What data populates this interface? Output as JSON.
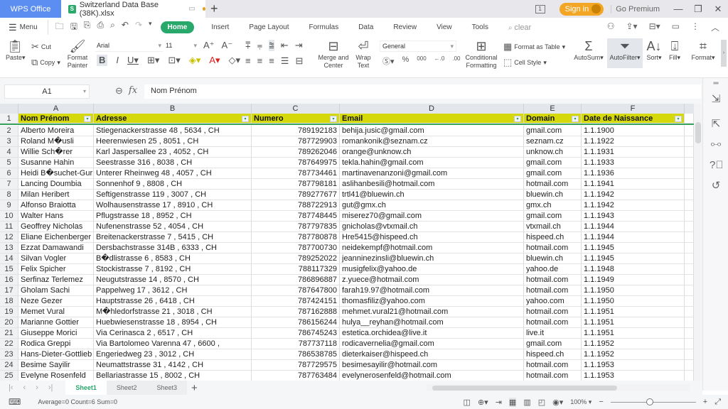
{
  "titlebar": {
    "app_tab": "WPS Office",
    "file_tab": "Switzerland Data Base (38K).xlsx",
    "file_icon": "S",
    "new_tab": "+",
    "window_count": "1",
    "sign_in": "Sign in",
    "go_premium": "Go Premium",
    "minimize": "—",
    "restore": "❐",
    "close": "✕"
  },
  "menubar": {
    "menu": "Menu",
    "tabs": [
      "Home",
      "Insert",
      "Page Layout",
      "Formulas",
      "Data",
      "Review",
      "View",
      "Tools"
    ],
    "search": "clear"
  },
  "ribbon": {
    "paste": "Paste",
    "cut": "Cut",
    "copy": "Copy",
    "format_painter": "Format Painter",
    "font": "Arial",
    "font_size": "11",
    "merge_center": "Merge and Center",
    "wrap_text": "Wrap Text",
    "number_format": "General",
    "conditional_formatting": "Conditional Formatting",
    "format_as_table": "Format as Table",
    "cell_style": "Cell Style",
    "autosum": "AutoSum",
    "autofilter": "AutoFilter",
    "sort": "Sort",
    "fill": "Fill",
    "format": "Format"
  },
  "formulabar": {
    "cell_ref": "A1",
    "fx": "fx",
    "content": "Nom Prénom"
  },
  "grid": {
    "columns": [
      "A",
      "B",
      "C",
      "D",
      "E",
      "F"
    ],
    "headers": [
      "Nom Prénom",
      "Adresse",
      "Numero",
      "Email",
      "Domain",
      "Date de Naissance"
    ],
    "rows": [
      {
        "n": "2",
        "name": "Alberto Moreira",
        "addr": "Stiegenackerstrasse  48  ,  5634  ,  CH",
        "num": "789192183",
        "email": "behija.jusic@gmail.com",
        "domain": "gmail.com",
        "date": "1.1.1900"
      },
      {
        "n": "3",
        "name": "Roland M�usli",
        "addr": "Heerenwiesen  25  ,  8051  ,  CH",
        "num": "787729903",
        "email": "romankonik@seznam.cz",
        "domain": "seznam.cz",
        "date": "1.1.1922"
      },
      {
        "n": "4",
        "name": "Willie Sch�rer",
        "addr": "Karl  Jaspersallee  23  ,  4052  ,  CH",
        "num": "789262046",
        "email": "orange@unknow.ch",
        "domain": "unknow.ch",
        "date": "1.1.1931"
      },
      {
        "n": "5",
        "name": "Susanne Hahin",
        "addr": "Seestrasse  316  ,  8038  ,  CH",
        "num": "787649975",
        "email": "tekla.hahin@gmail.com",
        "domain": "gmail.com",
        "date": "1.1.1933"
      },
      {
        "n": "6",
        "name": "Heidi B�suchet-Gur",
        "addr": "Unterer  Rheinweg  48  ,  4057  ,  CH",
        "num": "787734461",
        "email": "martinavenanzoni@gmail.com",
        "domain": "gmail.com",
        "date": "1.1.1936"
      },
      {
        "n": "7",
        "name": "Lancing Doumbia",
        "addr": "Sonnenhof  9  ,  8808  ,  CH",
        "num": "787798181",
        "email": "aslihanbesili@hotmail.com",
        "domain": "hotmail.com",
        "date": "1.1.1941"
      },
      {
        "n": "8",
        "name": "Milan Heribert",
        "addr": "Seftigenstrasse  119  ,  3007  ,  CH",
        "num": "789277677",
        "email": "trtl41@bluewin.ch",
        "domain": "bluewin.ch",
        "date": "1.1.1942"
      },
      {
        "n": "9",
        "name": "Alfonso Braiotta",
        "addr": "Wolhausenstrasse  17  ,  8910  ,  CH",
        "num": "788722913",
        "email": "gut@gmx.ch",
        "domain": "gmx.ch",
        "date": "1.1.1942"
      },
      {
        "n": "10",
        "name": "Walter Hans",
        "addr": "Pflugstrasse  18  ,  8952  ,  CH",
        "num": "787748445",
        "email": "miserez70@gmail.com",
        "domain": "gmail.com",
        "date": "1.1.1943"
      },
      {
        "n": "11",
        "name": "Geoffrey Nicholas",
        "addr": "Nufenenstrasse  52  ,  4054  ,  CH",
        "num": "787797835",
        "email": "gnicholas@vtxmail.ch",
        "domain": "vtxmail.ch",
        "date": "1.1.1944"
      },
      {
        "n": "12",
        "name": "Eliane Eichenberger",
        "addr": "Breitenackerstrasse  7  ,  5415  ,  CH",
        "num": "787780878",
        "email": "Hre5415@hispeed.ch",
        "domain": "hispeed.ch",
        "date": "1.1.1944"
      },
      {
        "n": "13",
        "name": "Ezzat Damawandi",
        "addr": "Dersbachstrasse  314B  ,  6333  ,  CH",
        "num": "787700730",
        "email": "neidekempf@hotmail.com",
        "domain": "hotmail.com",
        "date": "1.1.1945"
      },
      {
        "n": "14",
        "name": "Silvan Vogler",
        "addr": "B�dlistrasse  6  ,  8583  ,  CH",
        "num": "789252022",
        "email": "jeanninezinsli@bluewin.ch",
        "domain": "bluewin.ch",
        "date": "1.1.1945"
      },
      {
        "n": "15",
        "name": "Felix Spicher",
        "addr": "Stockistrasse  7  ,  8192  ,  CH",
        "num": "788117329",
        "email": "musigfelix@yahoo.de",
        "domain": "yahoo.de",
        "date": "1.1.1948"
      },
      {
        "n": "16",
        "name": "Serfinaz Terlemez",
        "addr": "Neugutstrasse  14  ,  8570  ,  CH",
        "num": "786896887",
        "email": "z.yuece@hotmail.com",
        "domain": "hotmail.com",
        "date": "1.1.1949"
      },
      {
        "n": "17",
        "name": "Gholam Sachi",
        "addr": "Pappelweg  17  ,  3612  ,  CH",
        "num": "787647800",
        "email": "farah19.97@hotmail.com",
        "domain": "hotmail.com",
        "date": "1.1.1950"
      },
      {
        "n": "18",
        "name": "Neze Gezer",
        "addr": "Hauptstrasse  26  ,  6418  ,  CH",
        "num": "787424151",
        "email": "thomasfiliz@yahoo.com",
        "domain": "yahoo.com",
        "date": "1.1.1950"
      },
      {
        "n": "19",
        "name": "Memet Vural",
        "addr": "M�hledorfstrasse  21  ,  3018  ,  CH",
        "num": "787162888",
        "email": "mehmet.vural21@hotmail.com",
        "domain": "hotmail.com",
        "date": "1.1.1951"
      },
      {
        "n": "20",
        "name": "Marianne Gottier",
        "addr": "Huebwiesenstrasse  18  ,  8954  ,  CH",
        "num": "786156244",
        "email": "hulya__reyhan@hotmail.com",
        "domain": "hotmail.com",
        "date": "1.1.1951"
      },
      {
        "n": "21",
        "name": "Giuseppe Morici",
        "addr": "Via  Cerinasca  2  ,  6517  ,  CH",
        "num": "786745243",
        "email": "estetica.orchidea@live.it",
        "domain": "live.it",
        "date": "1.1.1951"
      },
      {
        "n": "22",
        "name": "Rodica Greppi",
        "addr": "Via  Bartolomeo  Varenna  47  ,  6600  ,",
        "num": "787737118",
        "email": "rodicavernelia@gmail.com",
        "domain": "gmail.com",
        "date": "1.1.1952"
      },
      {
        "n": "23",
        "name": "Hans-Dieter-Gottlieb",
        "addr": "Engeriedweg  23  ,  3012  ,  CH",
        "num": "786538785",
        "email": "dieterkaiser@hispeed.ch",
        "domain": "hispeed.ch",
        "date": "1.1.1952"
      },
      {
        "n": "24",
        "name": "Besime Sayilir",
        "addr": "Neumattstrasse  31  ,  4142  ,  CH",
        "num": "787729575",
        "email": "besimesayilir@hotmail.com",
        "domain": "hotmail.com",
        "date": "1.1.1953"
      },
      {
        "n": "25",
        "name": "Evelyne Rosenfeld",
        "addr": "Bellariastrasse  15  ,  8002  ,  CH",
        "num": "787763484",
        "email": "evelynerosenfeld@hotmail.com",
        "domain": "hotmail.com",
        "date": "1.1.1953"
      }
    ]
  },
  "sheets": {
    "tabs": [
      "Sheet1",
      "Sheet2",
      "Sheet3"
    ],
    "active": "Sheet1"
  },
  "status": {
    "summary": "Average=0  Count=6  Sum=0",
    "zoom": "100%"
  },
  "colors": {
    "accent": "#29a86b",
    "header_fill": "#d5d90c",
    "app_tab": "#5b8ef0",
    "sign_in": "#f2a623"
  }
}
